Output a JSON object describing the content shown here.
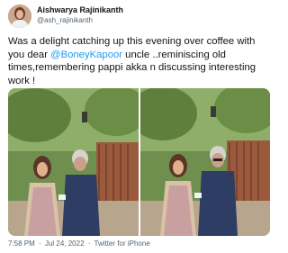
{
  "author": {
    "name": "Aishwarya Rajinikanth",
    "handle": "@ash_rajinikanth"
  },
  "tweet": {
    "text_before": "Was a delight catching up this evening over coffee with you dear ",
    "mention": "@BoneyKapoor",
    "text_after": " uncle ..reminiscing old times,remembering pappi akka n discussing interesting work !"
  },
  "meta": {
    "time": "7:58 PM",
    "separator": "·",
    "date": "Jul 24, 2022",
    "source": "Twitter for iPhone"
  },
  "colors": {
    "link": "#1d9bf0",
    "muted": "#536471"
  }
}
